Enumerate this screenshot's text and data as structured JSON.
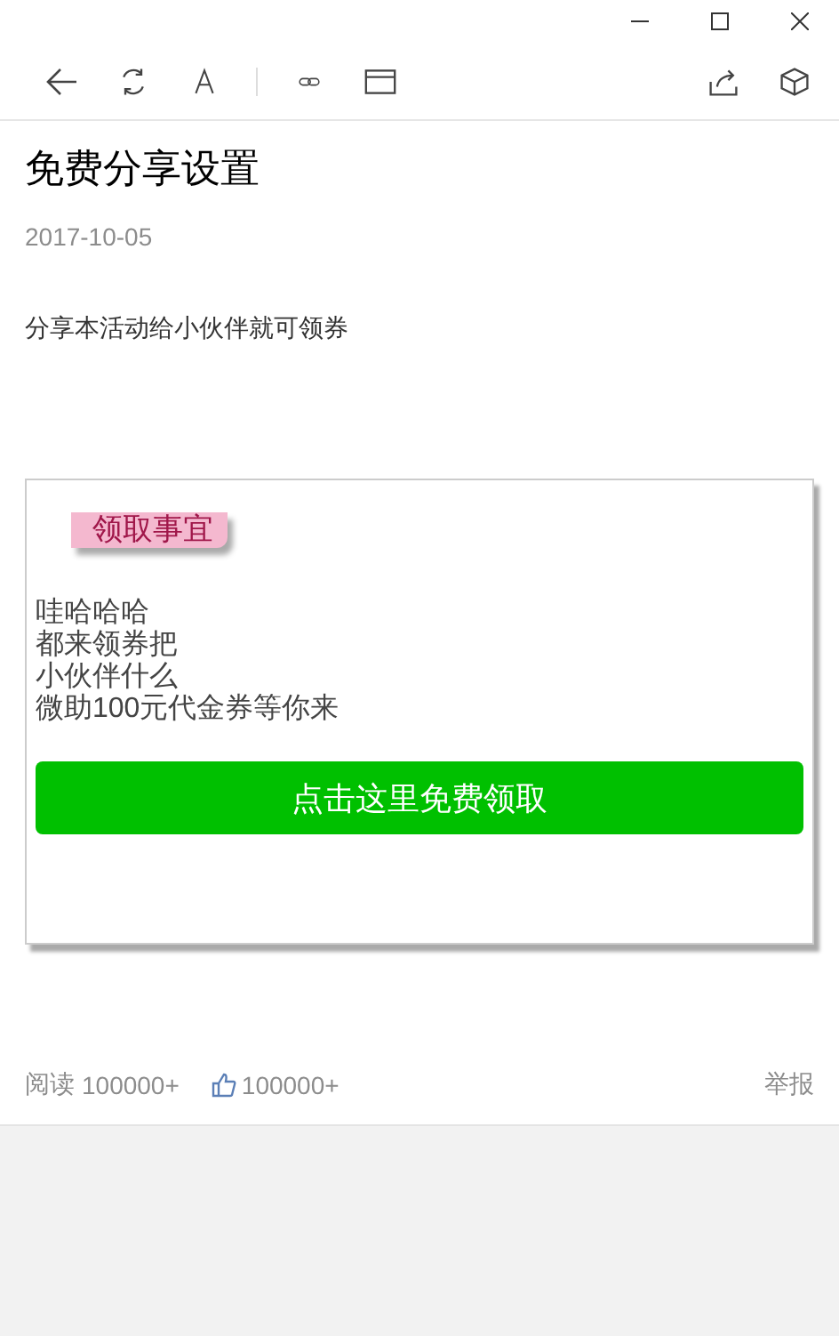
{
  "article": {
    "title": "免费分享设置",
    "date": "2017-10-05",
    "intro": "分享本活动给小伙伴就可领券"
  },
  "card": {
    "badge": "领取事宜",
    "lines": [
      "哇哈哈哈",
      "都来领券把",
      "小伙伴什么",
      "微助100元代金券等你来"
    ],
    "button": "点击这里免费领取"
  },
  "footer": {
    "read_label": "阅读",
    "read_count": "100000+",
    "likes": "100000+",
    "report": "举报"
  }
}
